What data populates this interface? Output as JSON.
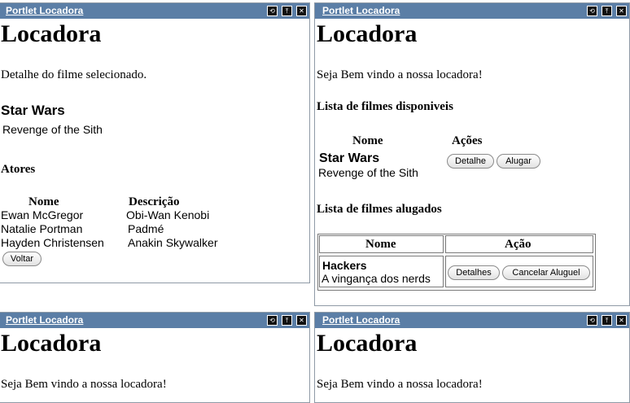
{
  "portlet_title": "Portlet Locadora",
  "controls": {
    "refresh": "⟲",
    "maximize": "⤒",
    "close": "✕"
  },
  "top_left": {
    "heading": "Locadora",
    "intro": "Detalhe do filme selecionado.",
    "film_title": "Star Wars",
    "film_subtitle": "Revenge of the Sith",
    "actors_heading": "Atores",
    "actors_columns": [
      "Nome",
      "Descrição"
    ],
    "actors": [
      {
        "name": "Ewan McGregor",
        "desc": "Obi-Wan Kenobi"
      },
      {
        "name": "Natalie Portman",
        "desc": "Padmé"
      },
      {
        "name": "Hayden Christensen",
        "desc": "Anakin Skywalker"
      }
    ],
    "back_button": "Voltar"
  },
  "top_right": {
    "heading": "Locadora",
    "welcome": "Seja Bem vindo a nossa locadora!",
    "available_heading": "Lista de filmes disponiveis",
    "available_columns": [
      "Nome",
      "Ações"
    ],
    "available": [
      {
        "title": "Star Wars",
        "subtitle": "Revenge of the Sith",
        "detail_button": "Detalhe",
        "rent_button": "Alugar"
      }
    ],
    "rented_heading": "Lista de filmes alugados",
    "rented_columns": [
      "Nome",
      "Ação"
    ],
    "rented": [
      {
        "title": "Hackers",
        "subtitle": "A vingança dos nerds",
        "details_button": "Detalhes",
        "cancel_button": "Cancelar Aluguel"
      }
    ]
  },
  "bottom_left": {
    "heading": "Locadora",
    "welcome": "Seja Bem vindo a nossa locadora!"
  },
  "bottom_right": {
    "heading": "Locadora",
    "welcome": "Seja Bem vindo a nossa locadora!"
  }
}
